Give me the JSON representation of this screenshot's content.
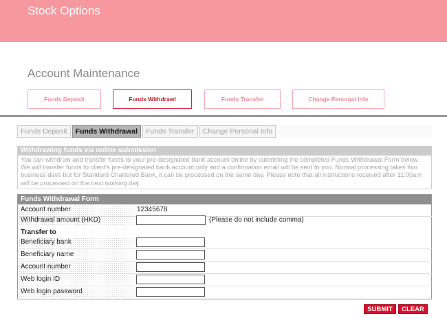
{
  "app": {
    "title": "Stock Options"
  },
  "page": {
    "title": "Account Maintenance"
  },
  "top_tabs": [
    {
      "label": "Funds Deposit",
      "active": false
    },
    {
      "label": "Funds Withdrawl",
      "active": true
    },
    {
      "label": "Funds Transfer",
      "active": false
    },
    {
      "label": "Change Personal Info",
      "active": false
    }
  ],
  "sub_tabs": [
    {
      "label": "Funds Deposit",
      "active": false
    },
    {
      "label": "Funds Withdrawal",
      "active": true
    },
    {
      "label": "Funds Transfer",
      "active": false
    },
    {
      "label": "Change Personal Info",
      "active": false
    }
  ],
  "info": {
    "heading": "Withdrawing funds via online submission",
    "text": "You can withdraw and transfer funds to your pre-designated bank account online by submitting the completed Funds Withdrawal Form below. We will transfer funds to client's pre-designated bank account only and a confirmation email will be sent to you. Normal processing takes two business days but for Standard Chartered Bank, it can be processed on the same day. Please note that all instructions received after 11:00am will be processed on the next working day."
  },
  "form": {
    "heading": "Funds Withdrawal Form",
    "account_number_label": "Account number",
    "account_number_value": "12345678",
    "amount_label": "Withdrawal amount (HKD)",
    "amount_value": "",
    "amount_hint": "(Please do not include comma)",
    "transfer_to_label": "Transfer to",
    "beneficiary_bank_label": "Beneficiary bank",
    "beneficiary_bank_value": "",
    "beneficiary_name_label": "Beneficiary name",
    "beneficiary_name_value": "",
    "transfer_account_label": "Account number",
    "transfer_account_value": "",
    "web_login_id_label": "Web login ID",
    "web_login_id_value": "",
    "web_login_password_label": "Web login password",
    "web_login_password_value": ""
  },
  "buttons": {
    "submit": "SUBMIT",
    "clear": "CLEAR"
  },
  "colors": {
    "brand": "#f7979e",
    "accent": "#d9102a",
    "tab_border": "#f4a7ae"
  }
}
